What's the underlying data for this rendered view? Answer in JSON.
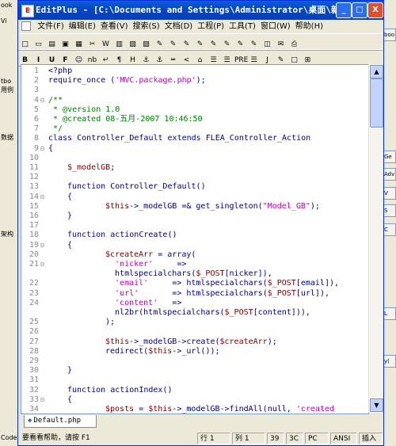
{
  "background_windows": {
    "left_labels": [
      "ook",
      "Vi",
      "tbo",
      "用例",
      "数据",
      "架构",
      "Code"
    ],
    "right_labels": [
      "boo",
      "Ge",
      "Adv",
      "V",
      "S",
      "C",
      "L",
      "y("
    ]
  },
  "window": {
    "title": "EditPlus - [C:\\Documents and Settings\\Administrator\\桌面\\新建...",
    "app_icon": "E",
    "buttons": {
      "minimize": "_",
      "maximize": "□",
      "close": "X"
    }
  },
  "menu": {
    "items": [
      "文件(F)",
      "编辑(E)",
      "查看(V)",
      "搜索(S)",
      "文档(D)",
      "工程(P)",
      "工具(T)",
      "窗口(W)",
      "帮助(H)"
    ]
  },
  "toolbar1": [
    "new",
    "open",
    "open-file",
    "save",
    "save-all",
    "cut",
    "word",
    "html",
    "browser",
    "paste",
    "q1",
    "q2",
    "q3",
    "q4",
    "q5",
    "q6",
    "q7",
    "q8",
    "preview",
    "clip",
    "print"
  ],
  "toolbar2": [
    "B",
    "I",
    "U",
    "F",
    "☺",
    "nb",
    "↵",
    "¶",
    "H",
    "⚓",
    "⚓",
    "═",
    "<",
    "⌂",
    "☰",
    "☰",
    "PRE",
    "☰",
    "J",
    "✎",
    "□",
    "⊞"
  ],
  "code": [
    {
      "n": "1",
      "fold": "",
      "indent": 0,
      "parts": [
        [
          "c-plain",
          "<?php"
        ]
      ]
    },
    {
      "n": "2",
      "fold": "",
      "indent": 0,
      "parts": [
        [
          "c-plain",
          "require_once ("
        ],
        [
          "c-str",
          "'MVC.package.php'"
        ],
        [
          "c-plain",
          ");"
        ]
      ]
    },
    {
      "n": "3",
      "fold": "",
      "indent": 0,
      "parts": []
    },
    {
      "n": "4",
      "fold": "⊟",
      "indent": 0,
      "parts": [
        [
          "c-cm",
          "/**"
        ]
      ]
    },
    {
      "n": "5",
      "fold": "",
      "indent": 0,
      "parts": [
        [
          "c-cm",
          " * @version 1.0"
        ]
      ]
    },
    {
      "n": "6",
      "fold": "",
      "indent": 0,
      "parts": [
        [
          "c-cm",
          " * @created 08-五月-2007 10:46:50"
        ]
      ]
    },
    {
      "n": "7",
      "fold": "",
      "indent": 0,
      "parts": [
        [
          "c-cm",
          " */"
        ]
      ]
    },
    {
      "n": "8",
      "fold": "",
      "indent": 0,
      "parts": [
        [
          "c-kw",
          "class"
        ],
        [
          "c-plain",
          " Controller_Default "
        ],
        [
          "c-kw",
          "extends"
        ],
        [
          "c-plain",
          " FLEA_Controller_Action"
        ]
      ]
    },
    {
      "n": "9",
      "fold": "⊟",
      "indent": 0,
      "parts": [
        [
          "c-plain",
          "{"
        ]
      ]
    },
    {
      "n": "10",
      "fold": "",
      "indent": 0,
      "parts": []
    },
    {
      "n": "11",
      "fold": "",
      "indent": 1,
      "parts": [
        [
          "c-var",
          "$_modelGB"
        ],
        [
          "c-plain",
          ";"
        ]
      ]
    },
    {
      "n": "12",
      "fold": "",
      "indent": 0,
      "parts": []
    },
    {
      "n": "13",
      "fold": "",
      "indent": 1,
      "parts": [
        [
          "c-kw",
          "function"
        ],
        [
          "c-plain",
          " Controller_Default()"
        ]
      ]
    },
    {
      "n": "14",
      "fold": "⊟",
      "indent": 1,
      "parts": [
        [
          "c-plain",
          "{"
        ]
      ]
    },
    {
      "n": "15",
      "fold": "",
      "indent": 3,
      "parts": [
        [
          "c-var",
          "$this"
        ],
        [
          "c-plain",
          "->_modelGB =& get_singleton("
        ],
        [
          "c-str",
          "\"Model_GB\""
        ],
        [
          "c-plain",
          ");"
        ]
      ]
    },
    {
      "n": "16",
      "fold": "",
      "indent": 1,
      "parts": [
        [
          "c-plain",
          "}"
        ]
      ]
    },
    {
      "n": "17",
      "fold": "",
      "indent": 0,
      "parts": []
    },
    {
      "n": "18",
      "fold": "",
      "indent": 1,
      "parts": [
        [
          "c-kw",
          "function"
        ],
        [
          "c-plain",
          " actionCreate()"
        ]
      ]
    },
    {
      "n": "19",
      "fold": "⊟",
      "indent": 1,
      "parts": [
        [
          "c-plain",
          "{"
        ]
      ]
    },
    {
      "n": "20",
      "fold": "",
      "indent": 3,
      "parts": [
        [
          "c-var",
          "$createArr"
        ],
        [
          "c-plain",
          " = "
        ],
        [
          "c-kw",
          "array"
        ],
        [
          "c-plain",
          "("
        ]
      ]
    },
    {
      "n": "21",
      "fold": "⊟",
      "indent": 3,
      "parts": [
        [
          "c-str",
          "  'nicker'"
        ],
        [
          "c-plain",
          "     =>"
        ]
      ]
    },
    {
      "n": "",
      "fold": "",
      "indent": 3,
      "parts": [
        [
          "c-plain",
          "  htmlspecialchars("
        ],
        [
          "c-var",
          "$_POST"
        ],
        [
          "c-plain",
          "[nicker]),"
        ]
      ]
    },
    {
      "n": "22",
      "fold": "",
      "indent": 3,
      "parts": [
        [
          "c-str",
          "  'email'"
        ],
        [
          "c-plain",
          "     => htmlspecialchars("
        ],
        [
          "c-var",
          "$_POST"
        ],
        [
          "c-plain",
          "[email]),"
        ]
      ]
    },
    {
      "n": "23",
      "fold": "",
      "indent": 3,
      "parts": [
        [
          "c-str",
          "  'url'"
        ],
        [
          "c-plain",
          "       => htmlspecialchars("
        ],
        [
          "c-var",
          "$_POST"
        ],
        [
          "c-plain",
          "[url]),"
        ]
      ]
    },
    {
      "n": "24",
      "fold": "",
      "indent": 3,
      "parts": [
        [
          "c-str",
          "  'content'"
        ],
        [
          "c-plain",
          "   =>"
        ]
      ]
    },
    {
      "n": "",
      "fold": "",
      "indent": 3,
      "parts": [
        [
          "c-plain",
          "  nl2br(htmlspecialchars("
        ],
        [
          "c-var",
          "$_POST"
        ],
        [
          "c-plain",
          "[content])),"
        ]
      ]
    },
    {
      "n": "25",
      "fold": "",
      "indent": 3,
      "parts": [
        [
          "c-plain",
          ");"
        ]
      ]
    },
    {
      "n": "26",
      "fold": "",
      "indent": 0,
      "parts": []
    },
    {
      "n": "27",
      "fold": "",
      "indent": 3,
      "parts": [
        [
          "c-var",
          "$this"
        ],
        [
          "c-plain",
          "->_modelGB->create("
        ],
        [
          "c-var",
          "$createArr"
        ],
        [
          "c-plain",
          ");"
        ]
      ]
    },
    {
      "n": "28",
      "fold": "",
      "indent": 3,
      "parts": [
        [
          "c-plain",
          "redirect("
        ],
        [
          "c-var",
          "$this"
        ],
        [
          "c-plain",
          "->_url());"
        ]
      ]
    },
    {
      "n": "29",
      "fold": "",
      "indent": 0,
      "parts": []
    },
    {
      "n": "30",
      "fold": "",
      "indent": 1,
      "parts": [
        [
          "c-plain",
          "}"
        ]
      ]
    },
    {
      "n": "31",
      "fold": "",
      "indent": 0,
      "parts": []
    },
    {
      "n": "32",
      "fold": "",
      "indent": 1,
      "parts": [
        [
          "c-kw",
          "function"
        ],
        [
          "c-plain",
          " actionIndex()"
        ]
      ]
    },
    {
      "n": "33",
      "fold": "⊟",
      "indent": 1,
      "parts": [
        [
          "c-plain",
          "{"
        ]
      ]
    },
    {
      "n": "34",
      "fold": "",
      "indent": 3,
      "parts": [
        [
          "c-var",
          "$posts"
        ],
        [
          "c-plain",
          " = "
        ],
        [
          "c-var",
          "$this"
        ],
        [
          "c-plain",
          "->_modelGB->findAll(null, "
        ],
        [
          "c-str",
          "'created"
        ]
      ]
    }
  ],
  "tab": {
    "label": "Default.php"
  },
  "status": {
    "help": "要看看帮助，请按 F1",
    "line": "行 1",
    "col": "列 1",
    "num": "39",
    "hex": "3C",
    "mode": "PC",
    "enc": "ANSI",
    "ins": "插入"
  },
  "colors": {
    "keyword": "#0000c0",
    "string": "#c000c0",
    "variable": "#800000",
    "comment": "#008000",
    "title_bar": "#0a5fd8"
  }
}
